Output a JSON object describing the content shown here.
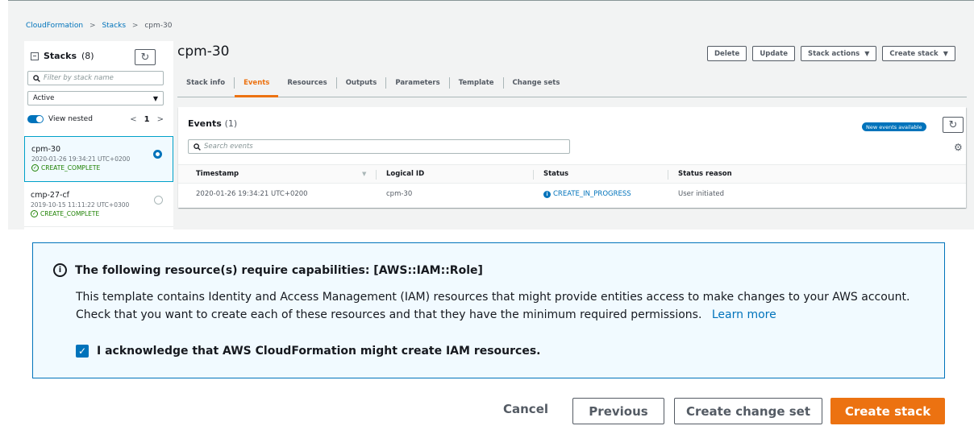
{
  "breadcrumb": {
    "item1": "CloudFormation",
    "item2": "Stacks",
    "item3": "cpm-30",
    "sep": ">"
  },
  "sidebar": {
    "title": "Stacks",
    "count": "(8)",
    "refresh_icon": "C",
    "filter_placeholder": "Filter by stack name",
    "status_filter": "Active",
    "view_nested_label": "View nested",
    "page": "1",
    "prev": "<",
    "next": ">",
    "stacks": [
      {
        "name": "cpm-30",
        "date": "2020-01-26 19:34:21 UTC+0200",
        "status": "CREATE_COMPLETE",
        "selected": true
      },
      {
        "name": "cmp-27-cf",
        "date": "2019-10-15 11:11:22 UTC+0300",
        "status": "CREATE_COMPLETE",
        "selected": false
      }
    ]
  },
  "stack": {
    "title": "cpm-30",
    "buttons": {
      "delete": "Delete",
      "update": "Update",
      "stack_actions": "Stack actions",
      "create_stack": "Create stack"
    },
    "tabs": [
      "Stack info",
      "Events",
      "Resources",
      "Outputs",
      "Parameters",
      "Template",
      "Change sets"
    ],
    "active_tab": "Events"
  },
  "events": {
    "title": "Events",
    "count": "(1)",
    "new_badge": "New events available",
    "search_placeholder": "Search events",
    "columns": [
      "Timestamp",
      "Logical ID",
      "Status",
      "Status reason"
    ],
    "rows": [
      {
        "timestamp": "2020-01-26 19:34:21 UTC+0200",
        "logical_id": "cpm-30",
        "status": "CREATE_IN_PROGRESS",
        "reason": "User initiated"
      }
    ]
  },
  "capabilities": {
    "heading": "The following resource(s) require capabilities: [AWS::IAM::Role]",
    "body_line1": "This template contains Identity and Access Management (IAM) resources that might provide entities access to make changes to your AWS account.",
    "body_line2": "Check that you want to create each of these resources and that they have the minimum required permissions.",
    "learn_more": "Learn more",
    "ack": "I acknowledge that AWS CloudFormation might create IAM resources.",
    "ack_checked": true
  },
  "footer": {
    "cancel": "Cancel",
    "previous": "Previous",
    "create_change_set": "Create change set",
    "create_stack": "Create stack"
  },
  "colors": {
    "accent": "#ec7211",
    "link": "#0073bb",
    "success": "#1d8102",
    "info_bg": "#f1faff"
  }
}
